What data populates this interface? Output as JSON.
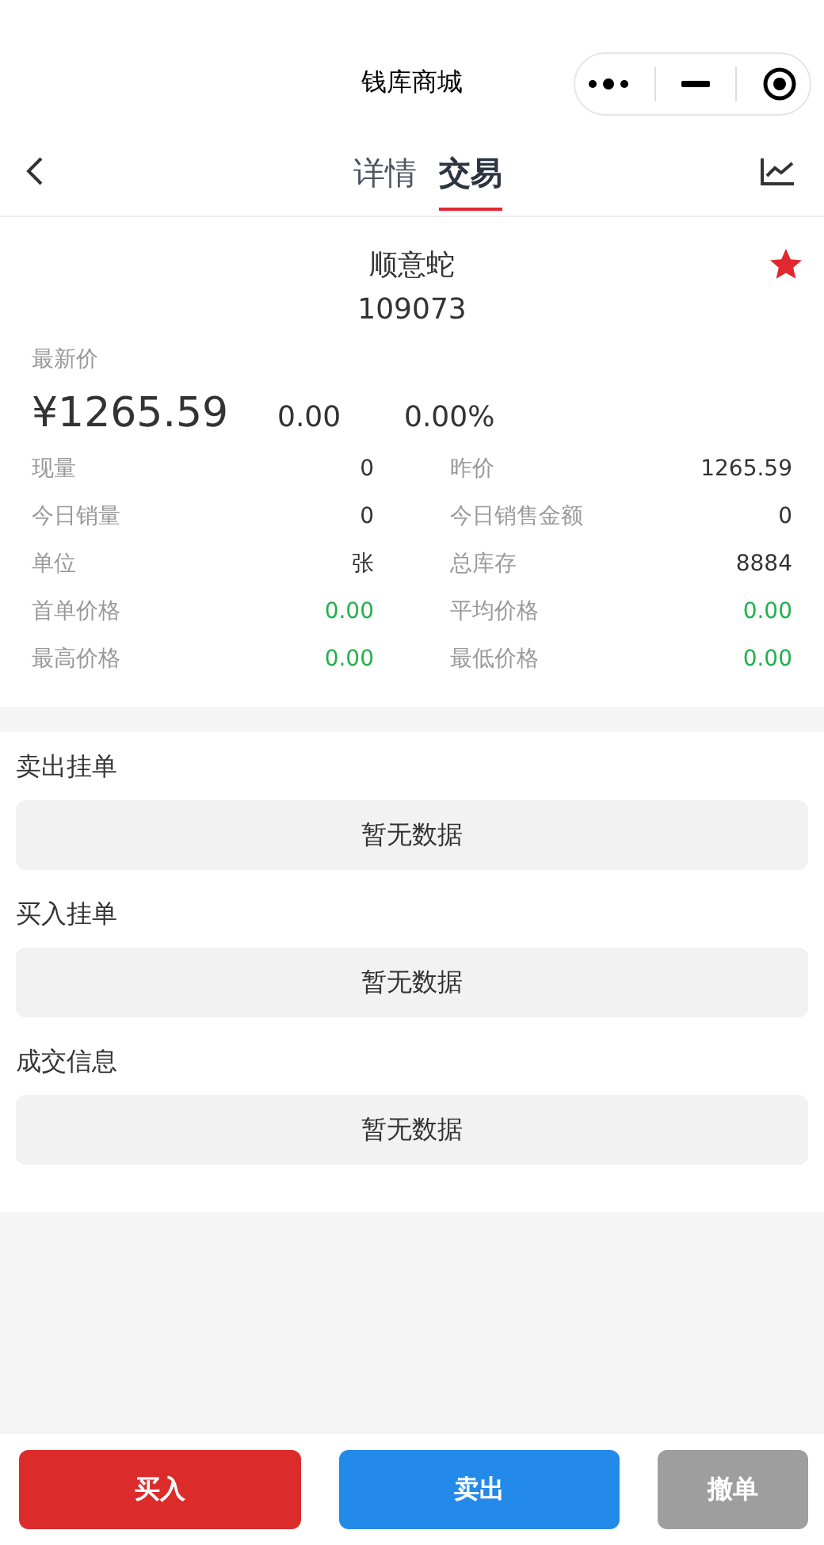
{
  "window": {
    "title": "钱库商城"
  },
  "nav": {
    "tabs": [
      {
        "label": "详情",
        "selected": false
      },
      {
        "label": "交易",
        "selected": true
      }
    ]
  },
  "product": {
    "name": "顺意蛇",
    "code": "109073",
    "favorited": true,
    "price_label": "最新价",
    "price": "¥1265.59",
    "change": "0.00",
    "change_pct": "0.00%",
    "stats": [
      {
        "label": "现量",
        "value": "0"
      },
      {
        "label": "昨价",
        "value": "1265.59"
      },
      {
        "label": "今日销量",
        "value": "0"
      },
      {
        "label": "今日销售金额",
        "value": "0"
      },
      {
        "label": "单位",
        "value": "张"
      },
      {
        "label": "总库存",
        "value": "8884"
      },
      {
        "label": "首单价格",
        "value": "0.00",
        "color": "#22b14c"
      },
      {
        "label": "平均价格",
        "value": "0.00",
        "color": "#22b14c"
      },
      {
        "label": "最高价格",
        "value": "0.00",
        "color": "#22b14c"
      },
      {
        "label": "最低价格",
        "value": "0.00",
        "color": "#22b14c"
      }
    ]
  },
  "sections": [
    {
      "title": "卖出挂单",
      "empty": "暂无数据"
    },
    {
      "title": "买入挂单",
      "empty": "暂无数据"
    },
    {
      "title": "成交信息",
      "empty": "暂无数据"
    }
  ],
  "actions": [
    {
      "label": "买入",
      "kind": "buy"
    },
    {
      "label": "卖出",
      "kind": "sell"
    },
    {
      "label": "撤单",
      "kind": "cancel"
    }
  ]
}
